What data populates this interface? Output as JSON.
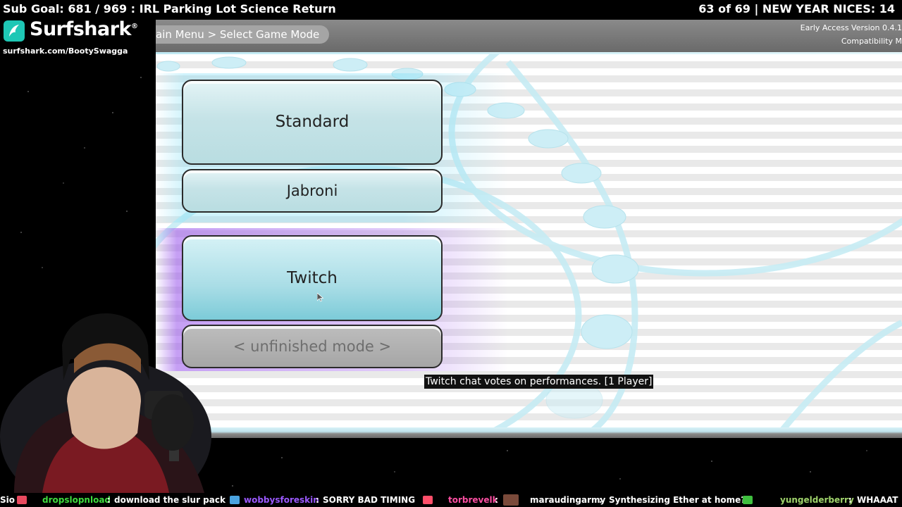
{
  "overlay": {
    "sub_goal": "Sub Goal: 681 / 969 : IRL Parking Lot Science Return",
    "nices": "63 of 69 | NEW YEAR NICES: 14"
  },
  "sponsor": {
    "name": "Surfshark",
    "url": "surfshark.com/BootySwagga"
  },
  "game": {
    "breadcrumb": "ain Menu > Select Game Mode",
    "version_line1": "Early Access Version 0.4.1",
    "version_line2": "Compatibility M",
    "modes": {
      "standard": "Standard",
      "jabroni": "Jabroni",
      "twitch": "Twitch",
      "unfinished": "< unfinished mode >"
    },
    "mode_description": "Twitch chat votes on performances. [1 Player]"
  },
  "chat": [
    {
      "prefix": "Sio",
      "user": "dropslopnload",
      "message": "download the slur pack",
      "user_color": "#3fdc3f"
    },
    {
      "user": "wobbysforeskin",
      "message": "SORRY BAD TIMING",
      "user_color": "#9b59ff"
    },
    {
      "user": "torbrevelk",
      "message": "",
      "user_color": "#ff4fa3"
    },
    {
      "user": "maraudingarmy",
      "message": "Synthesizing Ether at home?",
      "user_color": "#ffffff"
    },
    {
      "user": "yungelderberry",
      "message": "WHAAAT",
      "user_color": "#9fd36b"
    }
  ],
  "colors": {
    "accent_blue": "#7ccbd8",
    "accent_purple": "#9650eb"
  }
}
